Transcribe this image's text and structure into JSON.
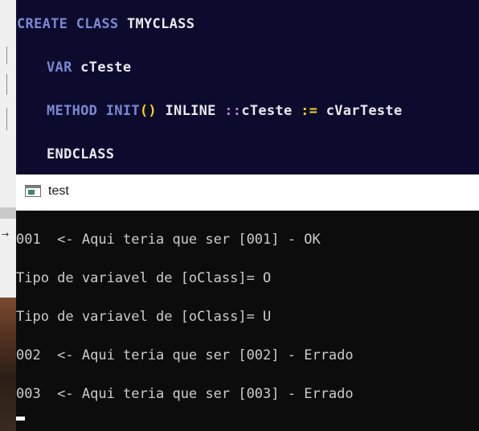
{
  "editor": {
    "lines": [
      [
        {
          "text": "CREATE CLASS ",
          "style": "keyword"
        },
        {
          "text": "TMYCLASS",
          "style": "identifier"
        }
      ],
      [
        {
          "text": "VAR ",
          "style": "keyword"
        },
        {
          "text": "cTeste",
          "style": "identifier"
        }
      ],
      [
        {
          "text": "METHOD INIT",
          "style": "keyword"
        },
        {
          "text": "()",
          "style": "paren"
        },
        {
          "text": " INLINE ",
          "style": "identifier"
        },
        {
          "text": "::",
          "style": "scope"
        },
        {
          "text": "cTeste ",
          "style": "identifier"
        },
        {
          "text": ":=",
          "style": "operator"
        },
        {
          "text": " cVarTeste",
          "style": "identifier"
        }
      ],
      [
        {
          "text": "ENDCLASS",
          "style": "identifier"
        }
      ]
    ]
  },
  "console": {
    "title": "test",
    "icon": "console-window-icon",
    "output": [
      "001  <- Aqui teria que ser [001] - OK",
      "Tipo de variavel de [oClass]= O",
      "Tipo de variavel de [oClass]= U",
      "002  <- Aqui teria que ser [002] - Errado",
      "003  <- Aqui teria que ser [003] - Errado"
    ]
  },
  "background_window": {
    "arrow_glyph": "→"
  },
  "colors": {
    "editor_background": "#0d0b2d",
    "keyword": "#7b88d1",
    "identifier": "#e8e8ee",
    "operator": "#f3d21a",
    "scope": "#b884d6",
    "console_background": "#0c0c0c",
    "console_text": "#cccccc"
  }
}
